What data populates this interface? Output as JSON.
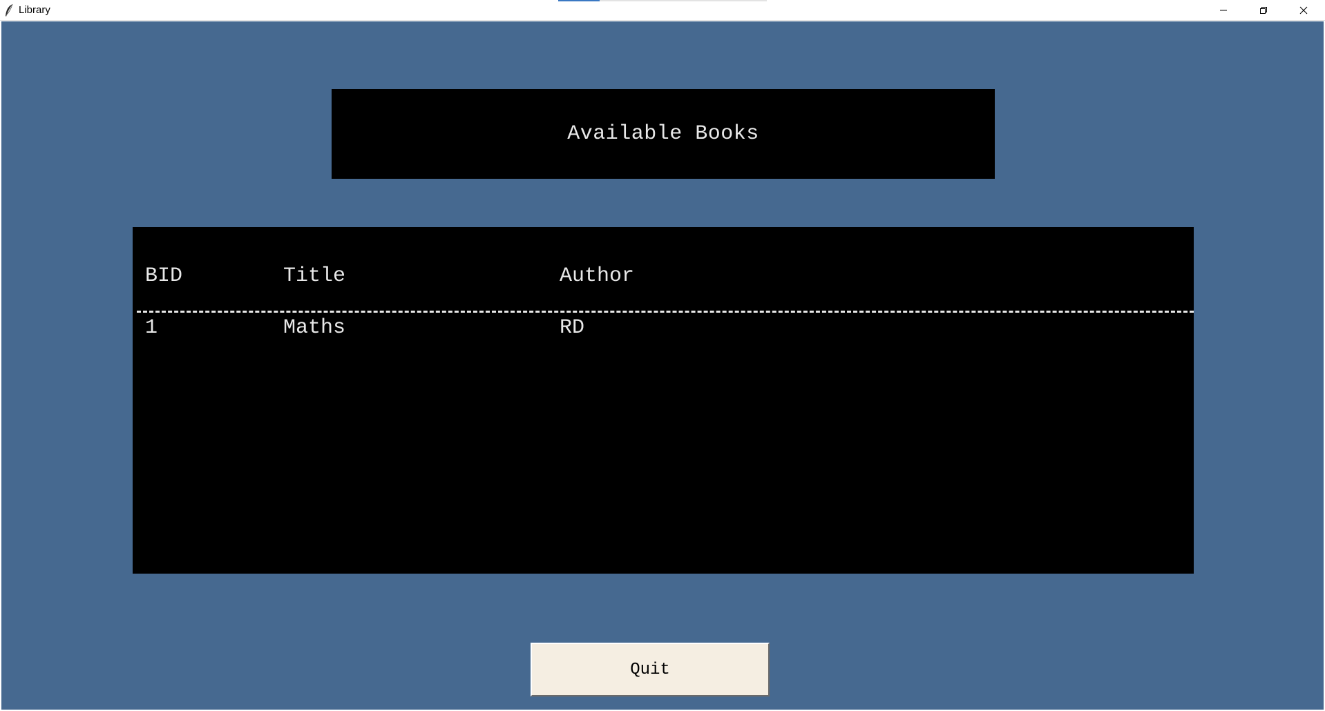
{
  "window": {
    "title": "Library",
    "icons": {
      "app": "feather-icon",
      "minimize": "minimize-icon",
      "maximize": "restore-icon",
      "close": "close-icon"
    }
  },
  "heading": {
    "text": "Available Books"
  },
  "table": {
    "columns": [
      "BID",
      "Title",
      "Author"
    ],
    "rows": [
      [
        "1",
        "Maths",
        "RD"
      ]
    ]
  },
  "actions": {
    "quit_label": "Quit"
  },
  "colors": {
    "background": "#466990",
    "panel": "#000000",
    "text": "#e8e8e8",
    "button": "#f5eee2"
  }
}
